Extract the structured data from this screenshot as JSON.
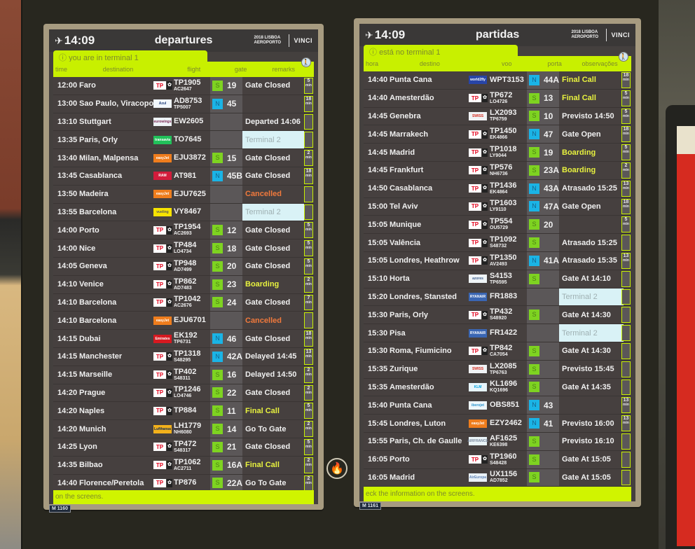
{
  "left_board": {
    "clock": "14:09",
    "title": "departures",
    "brand_logo": "2018 LISBOA AEROPORTO",
    "operator_logo": "VINCI",
    "terminal_notice": "you are in terminal 1",
    "columns": [
      "time",
      "destination",
      "flight",
      "gate",
      "remarks"
    ],
    "footer_text": "on the screens.",
    "model_tag": "M 1160",
    "rows": [
      {
        "time": "12:00",
        "destination": "Faro",
        "airline": "tap",
        "airline_label": "TP",
        "flight": "TP1905",
        "codeshare": "AC2647",
        "zone": "S",
        "gate": "19",
        "remark": "Gate Closed",
        "remark_style": "normal",
        "mins": "5"
      },
      {
        "time": "13:00",
        "destination": "Sao Paulo, Viracopos",
        "airline": "azul",
        "airline_label": "Azul",
        "flight": "AD8753",
        "codeshare": "TP5007",
        "zone": "N",
        "gate": "45",
        "remark": "",
        "remark_style": "normal",
        "mins": "18"
      },
      {
        "time": "13:10",
        "destination": "Stuttgart",
        "airline": "eurowings",
        "airline_label": "eurowings",
        "flight": "EW2605",
        "codeshare": "",
        "zone": "",
        "gate": "",
        "remark": "Departed 14:06",
        "remark_style": "normal",
        "mins": ""
      },
      {
        "time": "13:35",
        "destination": "Paris, Orly",
        "airline": "transavia",
        "airline_label": "transavia",
        "flight": "TO7645",
        "codeshare": "",
        "zone": "",
        "gate": "",
        "remark": "Terminal 2",
        "remark_style": "t2",
        "mins": ""
      },
      {
        "time": "13:40",
        "destination": "Milan, Malpensa",
        "airline": "easyjet",
        "airline_label": "easyJet",
        "flight": "EJU3872",
        "codeshare": "",
        "zone": "S",
        "gate": "15",
        "remark": "Gate Closed",
        "remark_style": "normal",
        "mins": "2"
      },
      {
        "time": "13:45",
        "destination": "Casablanca",
        "airline": "ram",
        "airline_label": "RAM",
        "flight": "AT981",
        "codeshare": "",
        "zone": "N",
        "gate": "45B",
        "remark": "Gate Closed",
        "remark_style": "normal",
        "mins": "18"
      },
      {
        "time": "13:50",
        "destination": "Madeira",
        "airline": "easyjet",
        "airline_label": "easyJet",
        "flight": "EJU7625",
        "codeshare": "",
        "zone": "",
        "gate": "",
        "remark": "Cancelled",
        "remark_style": "orange",
        "mins": ""
      },
      {
        "time": "13:55",
        "destination": "Barcelona",
        "airline": "vueling",
        "airline_label": "vueling",
        "flight": "VY8467",
        "codeshare": "",
        "zone": "",
        "gate": "",
        "remark": "Terminal 2",
        "remark_style": "t2",
        "mins": ""
      },
      {
        "time": "14:00",
        "destination": "Porto",
        "airline": "tap",
        "airline_label": "TP",
        "flight": "TP1954",
        "codeshare": "AC2693",
        "zone": "S",
        "gate": "12",
        "remark": "Gate Closed",
        "remark_style": "normal",
        "mins": "5"
      },
      {
        "time": "14:00",
        "destination": "Nice",
        "airline": "tap",
        "airline_label": "TP",
        "flight": "TP484",
        "codeshare": "LO4734",
        "zone": "S",
        "gate": "18",
        "remark": "Gate Closed",
        "remark_style": "normal",
        "mins": "5"
      },
      {
        "time": "14:05",
        "destination": "Geneva",
        "airline": "tap",
        "airline_label": "TP",
        "flight": "TP948",
        "codeshare": "AD7499",
        "zone": "S",
        "gate": "20",
        "remark": "Gate Closed",
        "remark_style": "normal",
        "mins": "5"
      },
      {
        "time": "14:10",
        "destination": "Venice",
        "airline": "tap",
        "airline_label": "TP",
        "flight": "TP862",
        "codeshare": "AD7483",
        "zone": "S",
        "gate": "23",
        "remark": "Boarding",
        "remark_style": "yellow",
        "mins": "2"
      },
      {
        "time": "14:10",
        "destination": "Barcelona",
        "airline": "tap",
        "airline_label": "TP",
        "flight": "TP1042",
        "codeshare": "AC2676",
        "zone": "S",
        "gate": "24",
        "remark": "Gate Closed",
        "remark_style": "normal",
        "mins": "7"
      },
      {
        "time": "14:10",
        "destination": "Barcelona",
        "airline": "easyjet",
        "airline_label": "easyJet",
        "flight": "EJU6701",
        "codeshare": "",
        "zone": "",
        "gate": "",
        "remark": "Cancelled",
        "remark_style": "orange",
        "mins": ""
      },
      {
        "time": "14:15",
        "destination": "Dubai",
        "airline": "emirates",
        "airline_label": "Emirates",
        "flight": "EK192",
        "codeshare": "TP6731",
        "zone": "N",
        "gate": "46",
        "remark": "Gate Closed",
        "remark_style": "normal",
        "mins": "18"
      },
      {
        "time": "14:15",
        "destination": "Manchester",
        "airline": "tap",
        "airline_label": "TP",
        "flight": "TP1318",
        "codeshare": "S48295",
        "zone": "N",
        "gate": "42A",
        "remark": "Delayed 14:45",
        "remark_style": "normal",
        "mins": "13"
      },
      {
        "time": "14:15",
        "destination": "Marseille",
        "airline": "tap",
        "airline_label": "TP",
        "flight": "TP402",
        "codeshare": "S48311",
        "zone": "S",
        "gate": "16",
        "remark": "Delayed 14:50",
        "remark_style": "normal",
        "mins": "2"
      },
      {
        "time": "14:20",
        "destination": "Prague",
        "airline": "tap",
        "airline_label": "TP",
        "flight": "TP1246",
        "codeshare": "LO4746",
        "zone": "S",
        "gate": "22",
        "remark": "Gate Closed",
        "remark_style": "normal",
        "mins": "2"
      },
      {
        "time": "14:20",
        "destination": "Naples",
        "airline": "tap",
        "airline_label": "TP",
        "flight": "TP884",
        "codeshare": "",
        "zone": "S",
        "gate": "11",
        "remark": "Final Call",
        "remark_style": "yellow",
        "mins": "5"
      },
      {
        "time": "14:20",
        "destination": "Munich",
        "airline": "lufthansa",
        "airline_label": "Lufthansa",
        "flight": "LH1779",
        "codeshare": "NH6080",
        "zone": "S",
        "gate": "14",
        "remark": "Go To Gate",
        "remark_style": "normal",
        "mins": "2"
      },
      {
        "time": "14:25",
        "destination": "Lyon",
        "airline": "tap",
        "airline_label": "TP",
        "flight": "TP472",
        "codeshare": "S48317",
        "zone": "S",
        "gate": "21",
        "remark": "Gate Closed",
        "remark_style": "normal",
        "mins": "5"
      },
      {
        "time": "14:35",
        "destination": "Bilbao",
        "airline": "tap",
        "airline_label": "TP",
        "flight": "TP1062",
        "codeshare": "AC2711",
        "zone": "S",
        "gate": "16A",
        "remark": "Final Call",
        "remark_style": "yellow",
        "mins": "2"
      },
      {
        "time": "14:40",
        "destination": "Florence/Peretola",
        "airline": "tap",
        "airline_label": "TP",
        "flight": "TP876",
        "codeshare": "",
        "zone": "S",
        "gate": "22A",
        "remark": "Go To Gate",
        "remark_style": "normal",
        "mins": "2"
      }
    ]
  },
  "right_board": {
    "clock": "14:09",
    "title": "partidas",
    "brand_logo": "2018 LISBOA AEROPORTO",
    "operator_logo": "VINCI",
    "terminal_notice": "está no terminal 1",
    "columns": [
      "hora",
      "destino",
      "voo",
      "porta",
      "observações"
    ],
    "footer_text": "eck the information on the screens.",
    "model_tag": "M 1161",
    "rows": [
      {
        "time": "14:40",
        "destination": "Punta Cana",
        "airline": "worldtofly",
        "airline_label": "world2fly",
        "flight": "WPT3153",
        "codeshare": "",
        "zone": "N",
        "gate": "44A",
        "remark": "Final Call",
        "remark_style": "yellow",
        "mins": "18"
      },
      {
        "time": "14:40",
        "destination": "Amesterdão",
        "airline": "tap",
        "airline_label": "TP",
        "flight": "TP672",
        "codeshare": "LO4726",
        "zone": "S",
        "gate": "13",
        "remark": "Final Call",
        "remark_style": "yellow",
        "mins": "5"
      },
      {
        "time": "14:45",
        "destination": "Genebra",
        "airline": "swiss",
        "airline_label": "SWISS",
        "flight": "LX2093",
        "codeshare": "TP6759",
        "zone": "S",
        "gate": "10",
        "remark": "Previsto 14:50",
        "remark_style": "normal",
        "mins": "5"
      },
      {
        "time": "14:45",
        "destination": "Marrakech",
        "airline": "tap",
        "airline_label": "TP",
        "flight": "TP1450",
        "codeshare": "EK4866",
        "zone": "N",
        "gate": "47",
        "remark": "Gate Open",
        "remark_style": "normal",
        "mins": "18"
      },
      {
        "time": "14:45",
        "destination": "Madrid",
        "airline": "tap",
        "airline_label": "TP",
        "flight": "TP1018",
        "codeshare": "LY9044",
        "zone": "S",
        "gate": "19",
        "remark": "Boarding",
        "remark_style": "yellow",
        "mins": "5"
      },
      {
        "time": "14:45",
        "destination": "Frankfurt",
        "airline": "tap",
        "airline_label": "TP",
        "flight": "TP576",
        "codeshare": "NH6736",
        "zone": "S",
        "gate": "23A",
        "remark": "Boarding",
        "remark_style": "yellow",
        "mins": "2"
      },
      {
        "time": "14:50",
        "destination": "Casablanca",
        "airline": "tap",
        "airline_label": "TP",
        "flight": "TP1436",
        "codeshare": "EK4864",
        "zone": "N",
        "gate": "43A",
        "remark": "Atrasado 15:25",
        "remark_style": "normal",
        "mins": "13"
      },
      {
        "time": "15:00",
        "destination": "Tel Aviv",
        "airline": "tap",
        "airline_label": "TP",
        "flight": "TP1603",
        "codeshare": "LY9110",
        "zone": "N",
        "gate": "47A",
        "remark": "Gate Open",
        "remark_style": "normal",
        "mins": "18"
      },
      {
        "time": "15:05",
        "destination": "Munique",
        "airline": "tap",
        "airline_label": "TP",
        "flight": "TP554",
        "codeshare": "OU5729",
        "zone": "S",
        "gate": "20",
        "remark": "",
        "remark_style": "normal",
        "mins": "5"
      },
      {
        "time": "15:05",
        "destination": "Valência",
        "airline": "tap",
        "airline_label": "TP",
        "flight": "TP1092",
        "codeshare": "S48732",
        "zone": "S",
        "gate": "",
        "remark": "Atrasado 15:25",
        "remark_style": "normal",
        "mins": ""
      },
      {
        "time": "15:05",
        "destination": "Londres, Heathrow",
        "airline": "tap",
        "airline_label": "TP",
        "flight": "TP1350",
        "codeshare": "AV2493",
        "zone": "N",
        "gate": "41A",
        "remark": "Atrasado 15:35",
        "remark_style": "normal",
        "mins": "13"
      },
      {
        "time": "15:10",
        "destination": "Horta",
        "airline": "sata",
        "airline_label": "azores",
        "flight": "S4153",
        "codeshare": "TP6595",
        "zone": "S",
        "gate": "",
        "remark": "Gate At 14:10",
        "remark_style": "normal",
        "mins": ""
      },
      {
        "time": "15:20",
        "destination": "Londres, Stansted",
        "airline": "ryanair",
        "airline_label": "RYANAIR",
        "flight": "FR1883",
        "codeshare": "",
        "zone": "",
        "gate": "",
        "remark": "Terminal 2",
        "remark_style": "t2",
        "mins": ""
      },
      {
        "time": "15:30",
        "destination": "Paris, Orly",
        "airline": "tap",
        "airline_label": "TP",
        "flight": "TP432",
        "codeshare": "S48920",
        "zone": "S",
        "gate": "",
        "remark": "Gate At 14:30",
        "remark_style": "normal",
        "mins": ""
      },
      {
        "time": "15:30",
        "destination": "Pisa",
        "airline": "ryanair",
        "airline_label": "RYANAIR",
        "flight": "FR1422",
        "codeshare": "",
        "zone": "",
        "gate": "",
        "remark": "Terminal 2",
        "remark_style": "t2",
        "mins": ""
      },
      {
        "time": "15:30",
        "destination": "Roma, Fiumicino",
        "airline": "tap",
        "airline_label": "TP",
        "flight": "TP842",
        "codeshare": "CA7054",
        "zone": "S",
        "gate": "",
        "remark": "Gate At 14:30",
        "remark_style": "normal",
        "mins": ""
      },
      {
        "time": "15:35",
        "destination": "Zurique",
        "airline": "swiss",
        "airline_label": "SWISS",
        "flight": "LX2085",
        "codeshare": "TP6763",
        "zone": "S",
        "gate": "",
        "remark": "Previsto 15:45",
        "remark_style": "normal",
        "mins": ""
      },
      {
        "time": "15:35",
        "destination": "Amesterdão",
        "airline": "klm",
        "airline_label": "KLM",
        "flight": "KL1696",
        "codeshare": "KQ1696",
        "zone": "S",
        "gate": "",
        "remark": "Gate At 14:35",
        "remark_style": "normal",
        "mins": ""
      },
      {
        "time": "15:40",
        "destination": "Punta Cana",
        "airline": "iberojet",
        "airline_label": "iberojet",
        "flight": "OBS851",
        "codeshare": "",
        "zone": "N",
        "gate": "43",
        "remark": "",
        "remark_style": "normal",
        "mins": "13"
      },
      {
        "time": "15:45",
        "destination": "Londres, Luton",
        "airline": "easyjet",
        "airline_label": "easyJet",
        "flight": "EZY2462",
        "codeshare": "",
        "zone": "N",
        "gate": "41",
        "remark": "Previsto 16:00",
        "remark_style": "normal",
        "mins": "13"
      },
      {
        "time": "15:55",
        "destination": "Paris, Ch. de Gaulle",
        "airline": "airfrance",
        "airline_label": "AIRFRANCE",
        "flight": "AF1625",
        "codeshare": "KE6398",
        "zone": "S",
        "gate": "",
        "remark": "Previsto 16:10",
        "remark_style": "normal",
        "mins": ""
      },
      {
        "time": "16:05",
        "destination": "Porto",
        "airline": "tap",
        "airline_label": "TP",
        "flight": "TP1960",
        "codeshare": "S48428",
        "zone": "S",
        "gate": "",
        "remark": "Gate At 15:05",
        "remark_style": "normal",
        "mins": ""
      },
      {
        "time": "16:05",
        "destination": "Madrid",
        "airline": "aireuropa",
        "airline_label": "AirEuropa",
        "flight": "UX1156",
        "codeshare": "AD7852",
        "zone": "S",
        "gate": "",
        "remark": "Gate At 15:05",
        "remark_style": "normal",
        "mins": ""
      }
    ]
  },
  "icons": {
    "plane": "✈",
    "info": "ⓘ",
    "walk": "🚶",
    "fire": "🔥",
    "mins_unit": "min"
  },
  "colors": {
    "accent_lime": "#c8f000",
    "row_bg": "#46403f",
    "gate_bg": "#5b5758",
    "zone_s": "#7ed321",
    "zone_n": "#1ab4e6",
    "remark_yellow": "#e8f23f",
    "remark_orange": "#f0793c",
    "terminal2_bg": "#d9f2f6"
  }
}
